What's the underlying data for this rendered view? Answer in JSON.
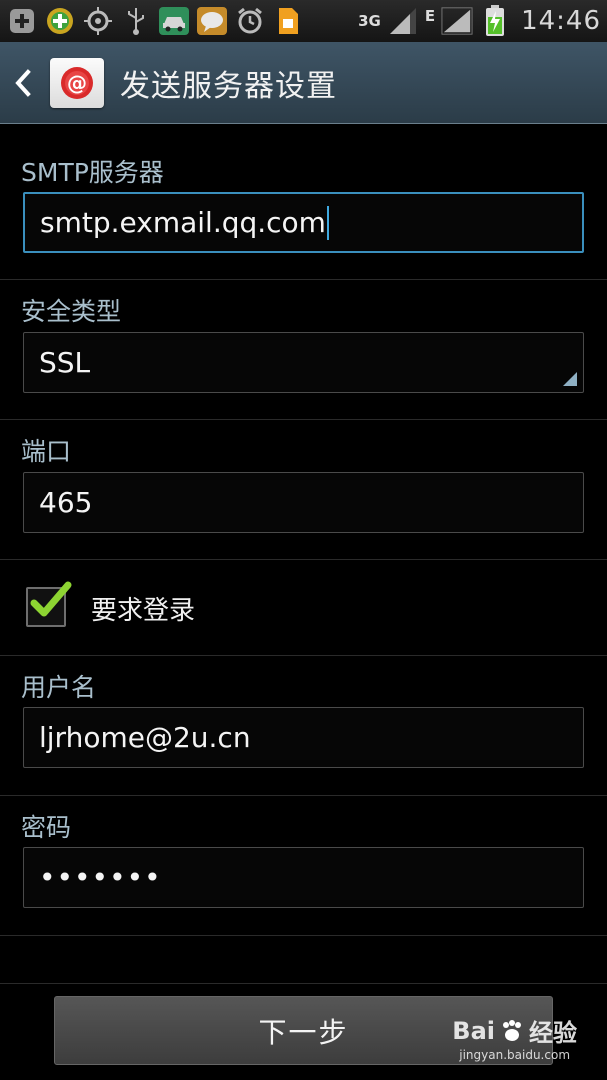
{
  "status_bar": {
    "network": "3G",
    "network_sub": "E",
    "time": "14:46"
  },
  "action_bar": {
    "title": "发送服务器设置"
  },
  "form": {
    "smtp_label": "SMTP服务器",
    "smtp_value": "smtp.exmail.qq.com",
    "security_label": "安全类型",
    "security_value": "SSL",
    "port_label": "端口",
    "port_value": "465",
    "require_login_label": "要求登录",
    "require_login_checked": true,
    "username_label": "用户名",
    "username_value": "ljrhome@2u.cn",
    "password_label": "密码",
    "password_value": "•••••••"
  },
  "next_button": "下一步",
  "watermark": {
    "brand": "Bai",
    "brand_suffix": "经验",
    "url": "jingyan.baidu.com"
  },
  "colors": {
    "action_bar": "#3f5566",
    "label": "#a9bfcc",
    "focus": "#3a8fbd",
    "check": "#8dd432"
  }
}
